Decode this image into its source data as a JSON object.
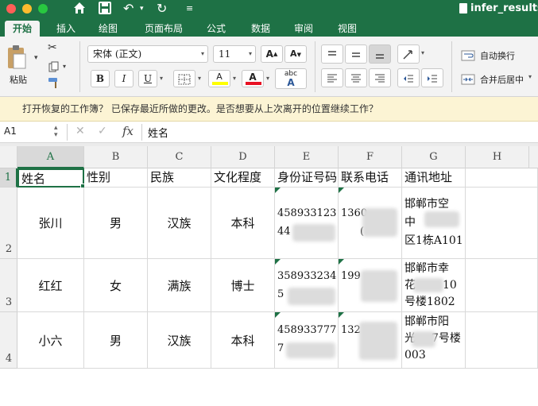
{
  "title_bar": {
    "doc_title": "infer_results",
    "qat_icons": [
      "home-icon",
      "save-icon",
      "undo-icon",
      "redo-icon",
      "customize-icon"
    ],
    "undo_glyph": "↶",
    "redo_glyph": "↻"
  },
  "tabs": [
    {
      "label": "开始",
      "active": true
    },
    {
      "label": "插入"
    },
    {
      "label": "绘图"
    },
    {
      "label": "页面布局"
    },
    {
      "label": "公式"
    },
    {
      "label": "数据"
    },
    {
      "label": "审阅"
    },
    {
      "label": "视图"
    }
  ],
  "ribbon": {
    "paste_label": "粘贴",
    "font_name": "宋体 (正文)",
    "font_size": "11",
    "grow_label": "A",
    "shrink_label": "A",
    "bold_label": "B",
    "italic_label": "I",
    "underline_label": "U",
    "phonetic_top": "abc",
    "phonetic_bottom": "A",
    "fill_label": "A",
    "fontcolor_label": "A",
    "wrap_text_label": "自动换行",
    "merge_center_label": "合并后居中",
    "fill_color": "#ffff00",
    "font_color": "#e81123"
  },
  "info_bar": {
    "message": "打开恢复的工作簿？ 已保存最近所做的更改。是否想要从上次离开的位置继续工作？"
  },
  "formula_bar": {
    "name_box": "A1",
    "fx_label": "fx",
    "content": "姓名"
  },
  "sheet": {
    "columns": [
      "A",
      "B",
      "C",
      "D",
      "E",
      "F",
      "G",
      "H"
    ],
    "row_numbers": [
      "1",
      "2",
      "3",
      "4"
    ],
    "headers": [
      "姓名",
      "性别",
      "民族",
      "文化程度",
      "身份证号码",
      "联系电话",
      "通讯地址"
    ],
    "rows": [
      {
        "name": "张川",
        "gender": "男",
        "ethnicity": "汉族",
        "education": "本科",
        "id_line1": "458933123",
        "id_line2": "44",
        "phone": "1360",
        "phone_tail": "(",
        "addr_lines": [
          "邯郸市空",
          "中",
          "区1栋A101"
        ]
      },
      {
        "name": "红红",
        "gender": "女",
        "ethnicity": "满族",
        "education": "博士",
        "id_line1": "358933234",
        "id_line2": "5",
        "phone": "199",
        "phone_tail": "",
        "addr_lines": [
          "邯郸市幸",
          "花",
          "10",
          "号楼1802"
        ]
      },
      {
        "name": "小六",
        "gender": "男",
        "ethnicity": "汉族",
        "education": "本科",
        "id_line1": "458933777",
        "id_line2": "7",
        "phone": "132",
        "phone_tail": "",
        "addr_lines": [
          "邯郸市阳",
          "光",
          "7号楼",
          "003"
        ]
      }
    ]
  }
}
